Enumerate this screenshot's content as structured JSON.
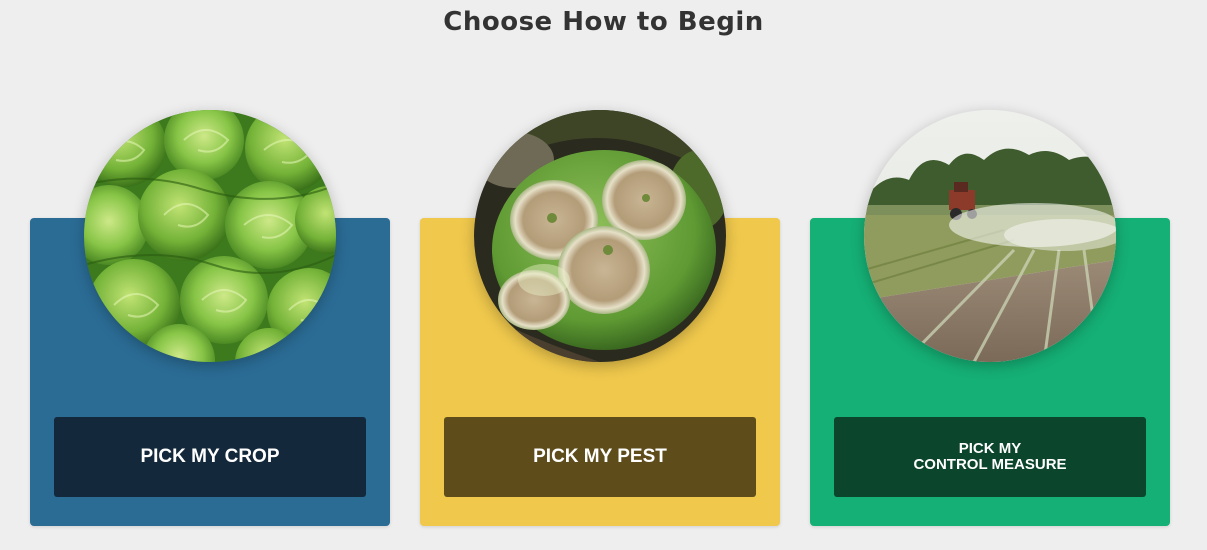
{
  "title": "Choose How to Begin",
  "cards": {
    "crop": {
      "button_label": "PICK MY CROP",
      "image": "lettuce-photo",
      "card_color": "#2b6c95",
      "button_color": "#13283a"
    },
    "pest": {
      "button_label": "PICK MY PEST",
      "image": "diseased-melon-photo",
      "card_color": "#efc84c",
      "button_color": "#5e4d1b"
    },
    "control": {
      "button_label_line1": "PICK MY",
      "button_label_line2": "CONTROL MEASURE",
      "image": "tractor-spraying-field-photo",
      "card_color": "#15b075",
      "button_color": "#0b452c"
    }
  }
}
